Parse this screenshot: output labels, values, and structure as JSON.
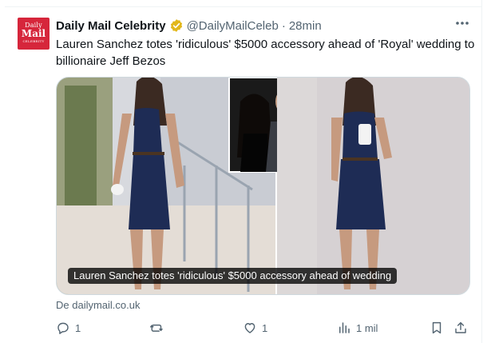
{
  "account": {
    "display_name": "Daily Mail Celebrity",
    "handle": "@DailyMailCeleb",
    "separator": "·",
    "time": "28min",
    "avatar_text": {
      "line1": "Daily",
      "line2": "Mail",
      "line3": "CELEBRITY"
    }
  },
  "tweet": {
    "text": "Lauren Sanchez totes 'ridiculous' $5000 accessory ahead of 'Royal' wedding to billionaire Jeff Bezos"
  },
  "card": {
    "caption": "Lauren Sanchez totes 'ridiculous' $5000 accessory ahead of wedding",
    "source": "De dailymail.co.uk"
  },
  "actions": {
    "replies": "1",
    "retweets": "",
    "likes": "1",
    "views": "1 mil"
  },
  "colors": {
    "verified": "#e2b719",
    "muted": "#536471",
    "dress": "#1e2c55"
  }
}
